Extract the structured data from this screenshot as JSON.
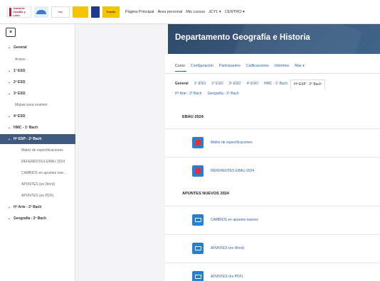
{
  "navbar": {
    "logos": {
      "jcyl": "Junta de Castilla y León",
      "fse": "fse",
      "eu": "",
      "fondo": "Fondo"
    },
    "links": [
      "Página Principal",
      "Área personal",
      "Mis cursos",
      "JCYL ▾",
      "CENTRO ▾"
    ]
  },
  "sidebar": {
    "close_label": "×",
    "items": [
      {
        "label": "General",
        "type": "section"
      },
      {
        "label": "Avisos",
        "type": "sub"
      },
      {
        "label": "1º ESO",
        "type": "section"
      },
      {
        "label": "2º ESO",
        "type": "section"
      },
      {
        "label": "3º ESO",
        "type": "section"
      },
      {
        "label": "Mapas para examen",
        "type": "sub"
      },
      {
        "label": "4º ESO",
        "type": "section"
      },
      {
        "label": "HMC - 1º Bach",
        "type": "section"
      },
      {
        "label": "Hª ESP - 2º Bach",
        "type": "section",
        "active": true
      },
      {
        "label": "Matriz de especificaciones",
        "type": "deep"
      },
      {
        "label": "REFERENTES EBAU 2024",
        "type": "deep"
      },
      {
        "label": "CAMBIOS en apuntes nue...",
        "type": "deep"
      },
      {
        "label": "APUNTES (en Word)",
        "type": "deep"
      },
      {
        "label": "APUNTES (en PDF)",
        "type": "deep"
      },
      {
        "label": "Hª Arte - 2º Bach",
        "type": "section"
      },
      {
        "label": "Geografía - 2º Bach",
        "type": "section"
      }
    ]
  },
  "header": {
    "title": "Departamento Geografía e Historia"
  },
  "tabs": [
    "Curso",
    "Configuración",
    "Participantes",
    "Calificaciones",
    "Informes",
    "Más ▾"
  ],
  "categories": {
    "row1": [
      "General",
      "1º ESO",
      "2º ESO",
      "3º ESO",
      "4º ESO",
      "HMC - 1º Bach",
      "Hª ESP - 2º Bach"
    ],
    "row2": [
      "Hª Arte - 2º Bach",
      "Geografía - 2º Bach"
    ]
  },
  "sections": [
    {
      "title": "EBAU 2024",
      "activities": [
        {
          "label": "Matriz de especificaciones",
          "icon": "pdf-icon"
        },
        {
          "label": "REFERENTES EBAU 2024",
          "icon": "pdf-icon"
        }
      ]
    },
    {
      "title": "APUNTES NUEVOS 2024",
      "activities": [
        {
          "label": "CAMBIOS en apuntes nuevos",
          "icon": "folder-icon"
        },
        {
          "label": "APUNTES (en Word)",
          "icon": "folder-icon"
        },
        {
          "label": "APUNTES (en PDF)",
          "icon": "folder-icon"
        }
      ]
    }
  ],
  "colors": {
    "accent": "#2c5f9e",
    "active_nav": "#3f5a7c",
    "banner": "#2f4a68",
    "icon_blue": "#2680cd",
    "pdf_red": "#e2303b"
  }
}
